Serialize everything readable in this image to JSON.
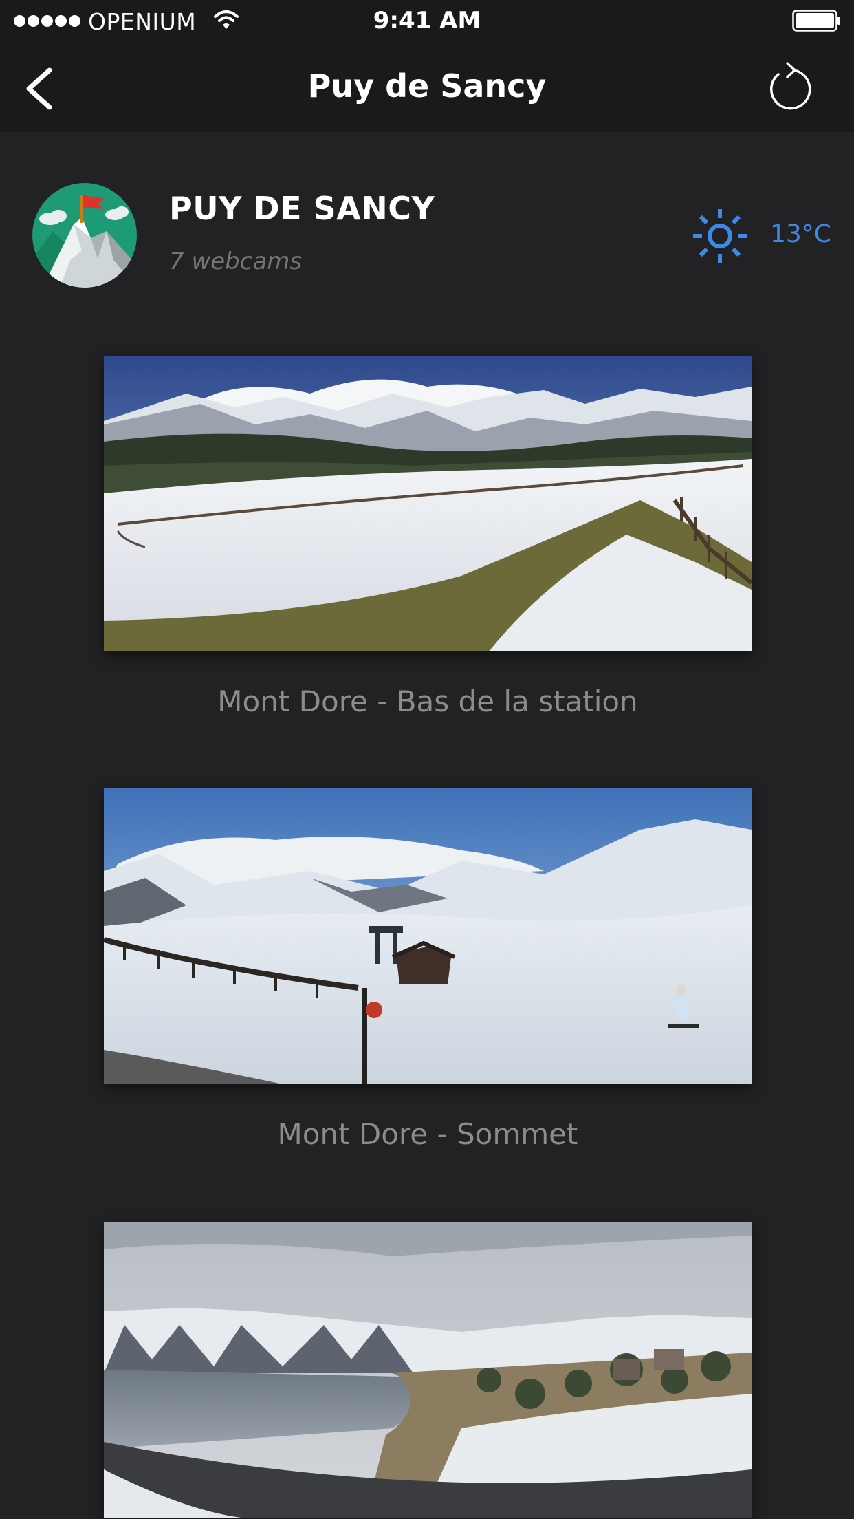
{
  "status_bar": {
    "carrier": "OPENIUM",
    "time": "9:41 AM"
  },
  "nav": {
    "title": "Puy de Sancy",
    "back_icon": "chevron-left-icon",
    "refresh_icon": "refresh-icon"
  },
  "station": {
    "name": "PUY DE SANCY",
    "webcam_count": "7 webcams",
    "weather_icon": "sun-icon",
    "temperature": "13°C"
  },
  "colors": {
    "background": "#222224",
    "bar": "#1a1a1a",
    "accent": "#3d8ae8",
    "caption": "#8c8c8c",
    "subtitle": "#757575"
  },
  "webcams": [
    {
      "caption": "Mont Dore - Bas de la station"
    },
    {
      "caption": "Mont Dore - Sommet"
    },
    {
      "caption": ""
    }
  ]
}
